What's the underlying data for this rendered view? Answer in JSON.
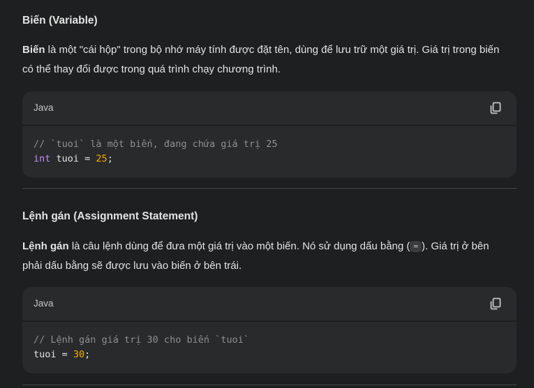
{
  "sections": [
    {
      "heading": "Biến (Variable)",
      "para_bold": "Biến",
      "para_text": " là một \"cái hộp\" trong bộ nhớ máy tính được đặt tên, dùng để lưu trữ một giá trị. Giá trị trong biến có thể thay đổi được trong quá trình chạy chương trình.",
      "code": {
        "language": "Java",
        "copy_icon": "copy-icon",
        "comment": "// `tuoi` là một biến, đang chứa giá trị 25",
        "keyword": "int",
        "statement": " tuoi = ",
        "number": "25",
        "end": ";"
      }
    },
    {
      "heading": "Lệnh gán (Assignment Statement)",
      "para_bold": "Lệnh gán",
      "para_text_before": " là câu lệnh dùng để đưa một giá trị vào một biến. Nó sử dụng dấu bằng (",
      "inline_code": "=",
      "para_text_after": "). Giá trị ở bên phải dấu bằng sẽ được lưu vào biến ở bên trái.",
      "code": {
        "language": "Java",
        "copy_icon": "copy-icon",
        "comment": "// Lệnh gán giá trị 30 cho biến `tuoi`",
        "statement": "tuoi = ",
        "number": "30",
        "end": ";"
      }
    }
  ],
  "colors": {
    "background": "#1e1f20",
    "card": "#282a2c",
    "keyword": "#c58af9",
    "number": "#f9ab00",
    "comment": "#8e918f"
  }
}
